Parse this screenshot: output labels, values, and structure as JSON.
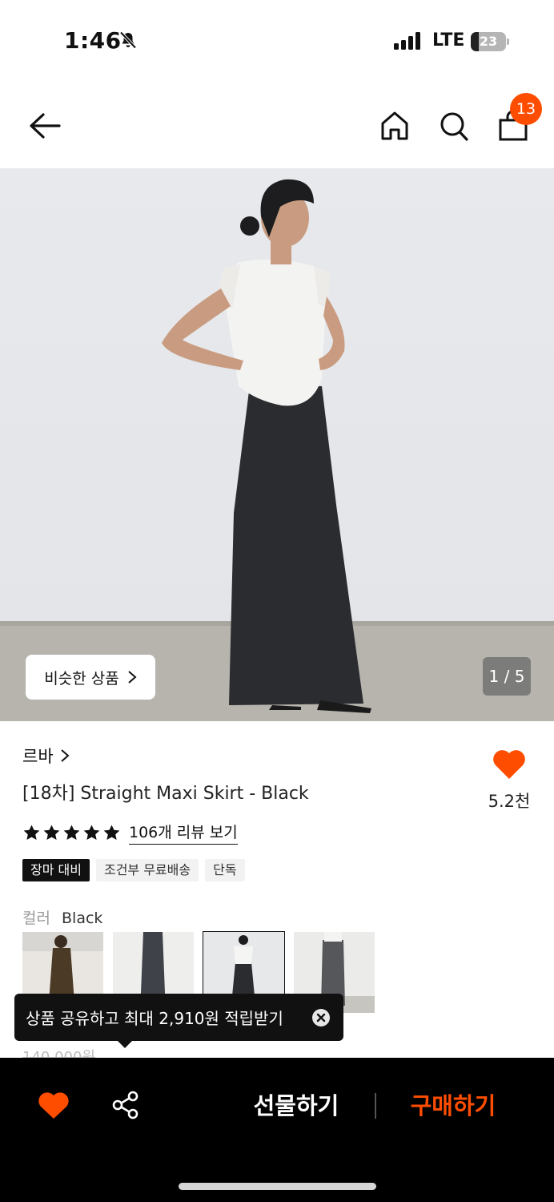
{
  "status_bar": {
    "time": "1:46",
    "network": "LTE",
    "battery": "23",
    "battery_level_percent": 23
  },
  "header": {
    "cart_count": "13",
    "icons": [
      "back-arrow-icon",
      "home-icon",
      "search-icon",
      "shopping-bag-icon"
    ]
  },
  "gallery": {
    "similar_button": "비슷한 상품",
    "page_indicator": "1 / 5"
  },
  "product": {
    "brand": "르바",
    "title": "[18차] Straight Maxi Skirt - Black",
    "like_count": "5.2천",
    "rating_stars": 5,
    "review_link": "106개 리뷰 보기",
    "tags": [
      "장마 대비",
      "조건부 무료배송",
      "단독"
    ],
    "color_label": "컬러",
    "color_value": "Black",
    "price_partial": "140,000원"
  },
  "tooltip": {
    "text": "상품 공유하고 최대 2,910원 적립받기"
  },
  "bottom_bar": {
    "gift_label": "선물하기",
    "buy_label": "구매하기"
  },
  "colors": {
    "accent": "#ff4d00",
    "bottom_bar_bg": "#000000"
  }
}
